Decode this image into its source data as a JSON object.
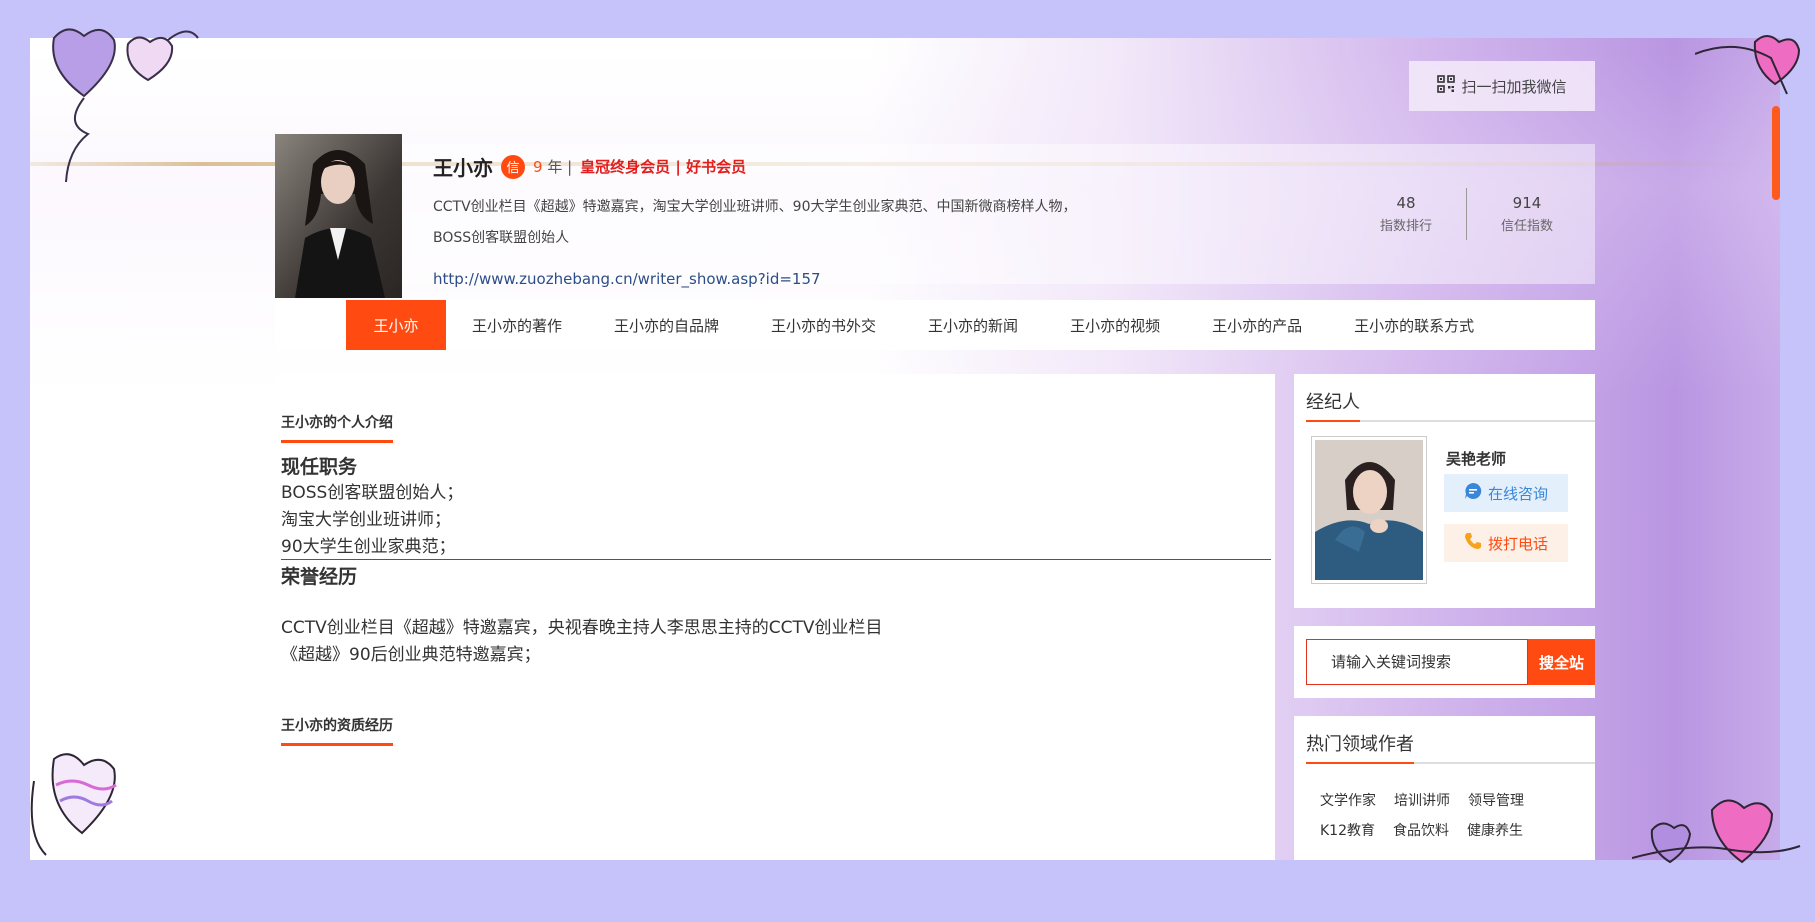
{
  "header": {
    "wechat_button": "扫一扫加我微信"
  },
  "profile": {
    "name": "王小亦",
    "badge": "信",
    "years_num": "9",
    "years_suffix": "年 |",
    "membership": "皇冠终身会员 | 好书会员",
    "bio": "CCTV创业栏目《超越》特邀嘉宾，淘宝大学创业班讲师、90大学生创业家典范、中国新微商榜样人物，BOSS创客联盟创始人",
    "url": "http://www.zuozhebang.cn/writer_show.asp?id=157",
    "stats": [
      {
        "value": "48",
        "label": "指数排行"
      },
      {
        "value": "914",
        "label": "信任指数"
      }
    ]
  },
  "nav": {
    "items": [
      {
        "label": "王小亦"
      },
      {
        "label": "王小亦的著作"
      },
      {
        "label": "王小亦的自品牌"
      },
      {
        "label": "王小亦的书外交"
      },
      {
        "label": "王小亦的新闻"
      },
      {
        "label": "王小亦的视频"
      },
      {
        "label": "王小亦的产品"
      },
      {
        "label": "王小亦的联系方式"
      }
    ]
  },
  "main": {
    "intro_title": "王小亦的个人介绍",
    "current_position_heading": "现任职务",
    "positions": [
      "BOSS创客联盟创始人；",
      "淘宝大学创业班讲师；",
      "90大学生创业家典范；"
    ],
    "honors_heading": "荣誉经历",
    "honors": [
      "CCTV创业栏目《超越》特邀嘉宾，央视春晚主持人李思思主持的CCTV创业栏目",
      "《超越》90后创业典范特邀嘉宾；"
    ],
    "qualification_title": "王小亦的资质经历"
  },
  "sidebar": {
    "agent": {
      "heading": "经纪人",
      "name": "吴艳老师",
      "consult_label": "在线咨询",
      "call_label": "拨打电话"
    },
    "search": {
      "placeholder": "请输入关键词搜索",
      "button": "搜全站"
    },
    "hot": {
      "heading": "热门领域作者",
      "tags": [
        "文学作家",
        "培训讲师",
        "领导管理",
        "K12教育",
        "食品饮料",
        "健康养生"
      ]
    }
  },
  "colors": {
    "accent": "#ff4b12",
    "page_bg": "#c6c3fa",
    "link": "#2c4d8a"
  }
}
